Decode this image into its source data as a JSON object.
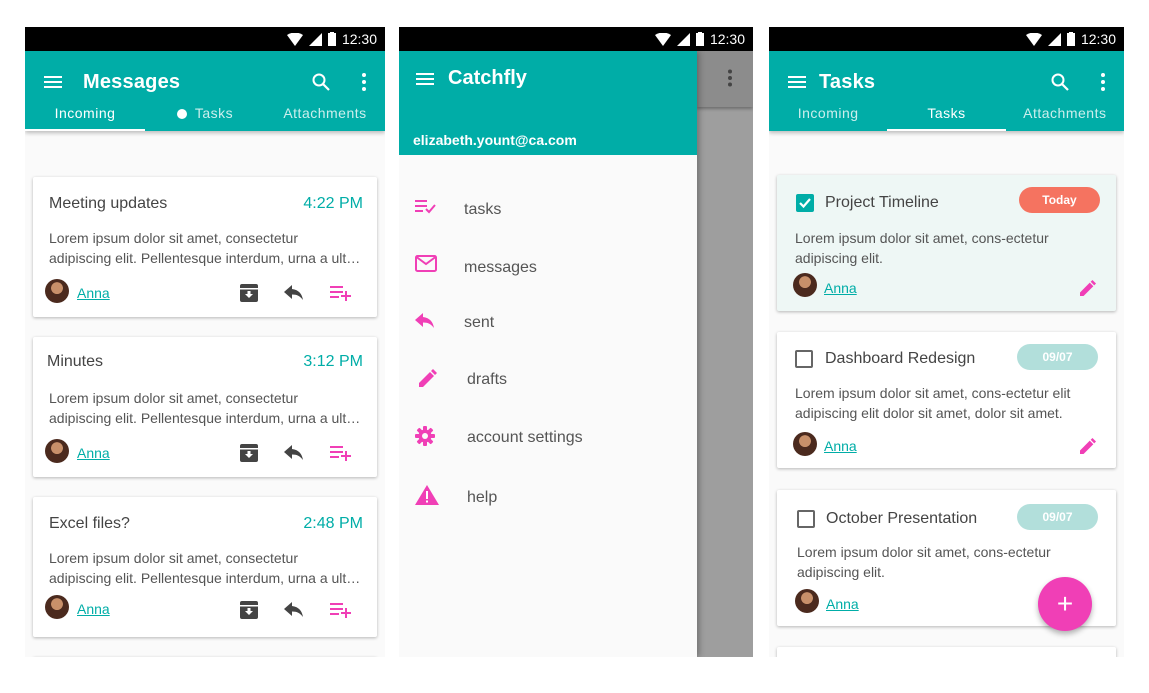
{
  "colors": {
    "teal": "#00ada7",
    "pink": "#f03fb6",
    "today": "#f57360",
    "datepill": "#b2dfdb"
  },
  "status": {
    "time": "12:30"
  },
  "messages_screen": {
    "title": "Messages",
    "tabs": [
      "Incoming",
      "Tasks",
      "Attachments"
    ],
    "cards": [
      {
        "title": "Meeting updates",
        "time": "4:22 PM",
        "line1": "Lorem ipsum dolor sit amet, consectetur",
        "line2": "adipiscing elit. Pellentesque interdum, urna a ultricies",
        "author": "Anna"
      },
      {
        "title": "Minutes",
        "time": "3:12 PM",
        "line1": "Lorem ipsum dolor sit amet, consectetur",
        "line2": "adipiscing elit. Pellentesque interdum, urna a ultricies",
        "author": "Anna"
      },
      {
        "title": "Excel files?",
        "time": "2:48 PM",
        "line1": "Lorem ipsum dolor sit amet, consectetur",
        "line2": "adipiscing elit. Pellentesque interdum, urna a ultricies",
        "author": "Anna"
      }
    ]
  },
  "drawer_screen": {
    "title": "Catchfly",
    "email": "elizabeth.yount@ca.com",
    "items": [
      "tasks",
      "messages",
      "sent",
      "drafts",
      "account settings",
      "help"
    ]
  },
  "tasks_screen": {
    "title": "Tasks",
    "tabs": [
      "Incoming",
      "Tasks",
      "Attachments"
    ],
    "cards": [
      {
        "title": "Project Timeline",
        "badge": "Today",
        "line1": "Lorem ipsum dolor sit amet, cons-ectetur",
        "line2": "adipiscing elit.",
        "author": "Anna",
        "checked": true
      },
      {
        "title": "Dashboard Redesign",
        "badge": "09/07",
        "line1": "Lorem ipsum dolor sit amet, cons-ectetur elit",
        "line2": "adipiscing elit dolor sit amet, dolor sit amet.",
        "author": "Anna",
        "checked": false
      },
      {
        "title": "October Presentation",
        "badge": "09/07",
        "line1": "Lorem ipsum dolor sit amet, cons-ectetur",
        "line2": "adipiscing elit.",
        "author": "Anna",
        "checked": false
      }
    ],
    "fab_label": "+"
  }
}
